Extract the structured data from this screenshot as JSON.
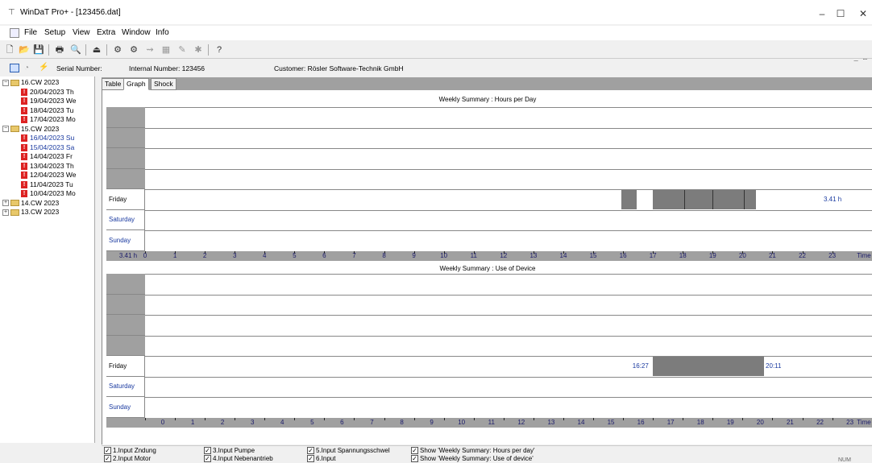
{
  "window": {
    "title": "WinDaT Pro+ - [123456.dat]"
  },
  "menu": [
    "File",
    "Setup",
    "View",
    "Extra",
    "Window",
    "Info"
  ],
  "info": {
    "serial_label": "Serial Number:",
    "internal_label": "Internal Number: 123456",
    "customer_label": "Customer: Rösler Software-Technik GmbH"
  },
  "tree": [
    {
      "label": "16.CW 2023",
      "type": "week",
      "expanded": true
    },
    {
      "label": "20/04/2023 Th",
      "type": "day"
    },
    {
      "label": "19/04/2023 We",
      "type": "day"
    },
    {
      "label": "18/04/2023 Tu",
      "type": "day"
    },
    {
      "label": "17/04/2023 Mo",
      "type": "day"
    },
    {
      "label": "15.CW 2023",
      "type": "week",
      "expanded": true
    },
    {
      "label": "16/04/2023 Su",
      "type": "day",
      "color": "#1a3aa0"
    },
    {
      "label": "15/04/2023 Sa",
      "type": "day",
      "color": "#1a3aa0"
    },
    {
      "label": "14/04/2023 Fr",
      "type": "day"
    },
    {
      "label": "13/04/2023 Th",
      "type": "day"
    },
    {
      "label": "12/04/2023 We",
      "type": "day"
    },
    {
      "label": "11/04/2023 Tu",
      "type": "day"
    },
    {
      "label": "10/04/2023 Mo",
      "type": "day"
    },
    {
      "label": "14.CW 2023",
      "type": "week",
      "expanded": false
    },
    {
      "label": "13.CW 2023",
      "type": "week",
      "expanded": false
    }
  ],
  "tabs": [
    "Table",
    "Graph",
    "Shock"
  ],
  "active_tab": "Graph",
  "chart1": {
    "title": "Weekly Summary : Hours per Day",
    "rows": [
      "",
      "",
      "",
      "",
      "Friday",
      "Saturday",
      "Sunday"
    ],
    "friday_total": "3.41 h",
    "axis_left": "3.41 h",
    "axis_unit": "Time",
    "hours": [
      "0",
      "1",
      "2",
      "3",
      "4",
      "5",
      "6",
      "7",
      "8",
      "9",
      "10",
      "11",
      "12",
      "13",
      "14",
      "15",
      "16",
      "17",
      "18",
      "19",
      "20",
      "21",
      "22",
      "23"
    ]
  },
  "chart2": {
    "title": "Weekly Summary : Use of Device",
    "rows": [
      "",
      "",
      "",
      "",
      "Friday",
      "Saturday",
      "Sunday"
    ],
    "start_time": "16:27",
    "end_time": "20:11",
    "axis_unit": "Time",
    "hours": [
      "0",
      "1",
      "2",
      "3",
      "4",
      "5",
      "6",
      "7",
      "8",
      "9",
      "10",
      "11",
      "12",
      "13",
      "14",
      "15",
      "16",
      "17",
      "18",
      "19",
      "20",
      "21",
      "22",
      "23"
    ]
  },
  "checkboxes": [
    {
      "label": "1.Input Zndung",
      "checked": true
    },
    {
      "label": "2.Input Motor",
      "checked": true
    },
    {
      "label": "3.Input Pumpe",
      "checked": true
    },
    {
      "label": "4.Input Nebenantrieb",
      "checked": true
    },
    {
      "label": "5.Input Spannungsschwel",
      "checked": true
    },
    {
      "label": "6.Input",
      "checked": true
    },
    {
      "label": "Show 'Weekly Summary: Hours per day'",
      "checked": true
    },
    {
      "label": "Show 'Weekly Summary: Use of device'",
      "checked": true
    }
  ],
  "status": {
    "num": "NUM"
  },
  "colors": {
    "bar": "#7c7c7c",
    "blue_text": "#1a3aa0",
    "grey": "#a0a0a0"
  }
}
